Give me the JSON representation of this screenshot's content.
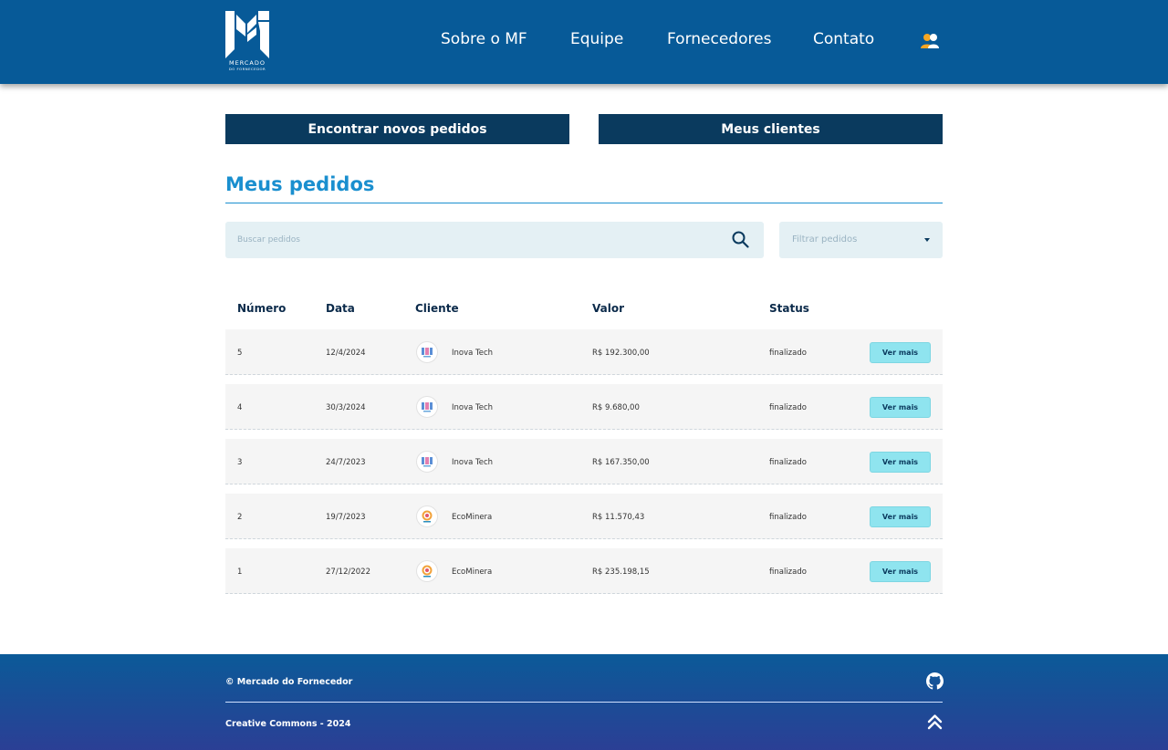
{
  "header": {
    "logo_text": "MERCADO",
    "logo_subtext": "DO FORNECEDOR",
    "nav": [
      {
        "label": "Sobre o MF"
      },
      {
        "label": "Equipe"
      },
      {
        "label": "Fornecedores"
      },
      {
        "label": "Contato"
      }
    ],
    "user_icon": "users-icon"
  },
  "actions": {
    "find_orders": "Encontrar novos pedidos",
    "my_clients": "Meus clientes"
  },
  "page_title": "Meus pedidos",
  "search": {
    "placeholder": "Buscar pedidos",
    "icon": "search-icon"
  },
  "filter": {
    "label": "Filtrar pedidos"
  },
  "table": {
    "headers": [
      "Número",
      "Data",
      "Cliente",
      "Valor",
      "Status"
    ],
    "rows": [
      {
        "numero": "5",
        "data": "12/4/2024",
        "cliente": "Inova Tech",
        "valor": "R$ 192.300,00",
        "status": "finalizado",
        "action": "Ver mais"
      },
      {
        "numero": "4",
        "data": "30/3/2024",
        "cliente": "Inova Tech",
        "valor": "R$ 9.680,00",
        "status": "finalizado",
        "action": "Ver mais"
      },
      {
        "numero": "3",
        "data": "24/7/2023",
        "cliente": "Inova Tech",
        "valor": "R$ 167.350,00",
        "status": "finalizado",
        "action": "Ver mais"
      },
      {
        "numero": "2",
        "data": "19/7/2023",
        "cliente": "EcoMinera",
        "valor": "R$ 11.570,43",
        "status": "finalizado",
        "action": "Ver mais"
      },
      {
        "numero": "1",
        "data": "27/12/2022",
        "cliente": "EcoMinera",
        "valor": "R$ 235.198,15",
        "status": "finalizado",
        "action": "Ver mais"
      }
    ]
  },
  "footer": {
    "copyright": "© Mercado do Fornecedor",
    "license": "Creative Commons - 2024"
  },
  "colors": {
    "header_bg": "#075a98",
    "accent": "#1a8fcf",
    "button_dark": "#0a3a5e",
    "button_light": "#8fe4ef"
  }
}
